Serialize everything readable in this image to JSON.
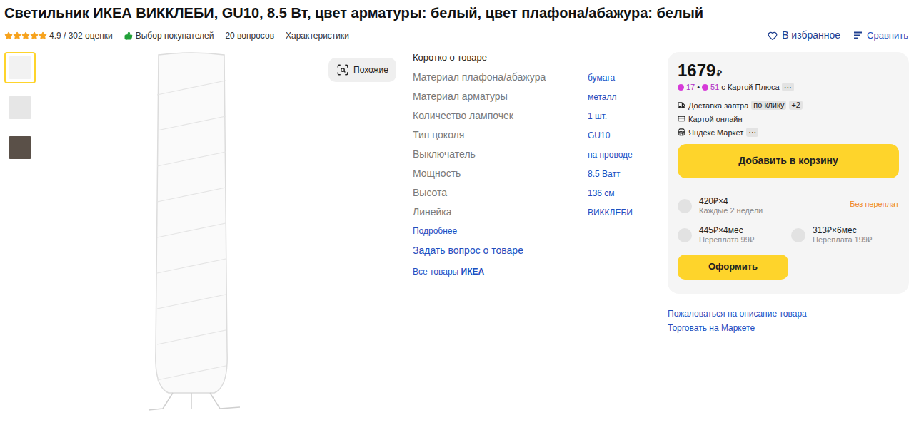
{
  "title": "Светильник ИКЕА ВИККЛЕБИ, GU10, 8.5 Вт, цвет арматуры: белый, цвет плафона/абажура: белый",
  "rating": {
    "stars": 5,
    "text": "4.9 / 302 оценки"
  },
  "badge": "Выбор покупателей",
  "links": [
    "20 вопросов",
    "Характеристики"
  ],
  "actions": {
    "favorite": "В избранное",
    "compare": "Сравнить"
  },
  "gallery": {
    "thumbnails": [
      {
        "selected": true
      },
      {
        "selected": false
      },
      {
        "selected": false
      }
    ],
    "similar_button": "Похожие"
  },
  "specs": {
    "heading": "Коротко о товаре",
    "rows": [
      {
        "label": "Материал плафона/абажура",
        "value": "бумага"
      },
      {
        "label": "Материал арматуры",
        "value": "металл"
      },
      {
        "label": "Количество лампочек",
        "value": "1 шт."
      },
      {
        "label": "Тип цоколя",
        "value": "GU10"
      },
      {
        "label": "Выключатель",
        "value": "на проводе"
      },
      {
        "label": "Мощность",
        "value": "8.5 Ватт"
      },
      {
        "label": "Высота",
        "value": "136 см"
      },
      {
        "label": "Линейка",
        "value": "ВИККЛЕБИ"
      }
    ],
    "more": "Подробнее",
    "ask": "Задать вопрос о товаре",
    "all_goods": {
      "prefix": "Все товары",
      "brand": "ИКЕА"
    }
  },
  "offer": {
    "price": "1679",
    "currency": "₽",
    "cashback": {
      "points": [
        "17",
        "51"
      ],
      "separator": "•",
      "note": "с Картой Плюса",
      "chip": "···"
    },
    "delivery": [
      {
        "kind": "delivery",
        "text": "Доставка завтра",
        "chip": "по клику",
        "extra": "+2"
      },
      {
        "kind": "payment",
        "text": "Картой онлайн",
        "chip": "",
        "extra": ""
      },
      {
        "kind": "seller",
        "text": "Яндекс Маркет",
        "chip": "···",
        "extra": ""
      }
    ],
    "cart_button": "Добавить в корзину",
    "installments": [
      {
        "amount": "420₽×4",
        "note": "Каждые 2 недели",
        "tag": "Без переплат",
        "selected": false
      },
      {
        "amount": "445₽×4мес",
        "note": "Переплата 99₽",
        "tag": "",
        "selected": false
      },
      {
        "amount": "313₽×6мес",
        "note": "Переплата 199₽",
        "tag": "",
        "selected": false
      }
    ],
    "checkout_button": "Оформить"
  },
  "footer_links": [
    "Пожаловаться на описание товара",
    "Торговать на Маркете"
  ]
}
